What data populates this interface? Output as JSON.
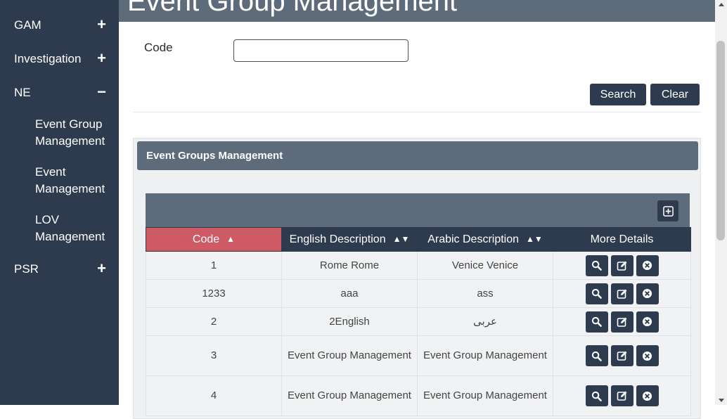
{
  "sidebar": {
    "items": [
      {
        "label": "GAM",
        "toggle": "+"
      },
      {
        "label": "Investigation",
        "toggle": "+"
      },
      {
        "label": "NE",
        "toggle": "−"
      },
      {
        "label": "PSR",
        "toggle": "+"
      }
    ],
    "sub_items": [
      "Event Group Management",
      "Event Management",
      "LOV Management"
    ]
  },
  "page": {
    "title": "Event Group Management"
  },
  "search": {
    "code_label": "Code",
    "code_value": "",
    "search_label": "Search",
    "clear_label": "Clear"
  },
  "panel": {
    "title": "Event Groups Management"
  },
  "table": {
    "columns": [
      "Code",
      "English Description",
      "Arabic Description",
      "More Details"
    ],
    "rows": [
      {
        "code": "1",
        "english": "Rome Rome",
        "arabic": "Venice Venice"
      },
      {
        "code": "1233",
        "english": "aaa",
        "arabic": "ass"
      },
      {
        "code": "2",
        "english": "2English",
        "arabic": "عربى"
      },
      {
        "code": "3",
        "english": "Event Group Management",
        "arabic": "Event Group Management"
      },
      {
        "code": "4",
        "english": "Event Group Management",
        "arabic": "Event Group Management"
      }
    ]
  },
  "colors": {
    "sidebar": "#2e3b4e",
    "header": "#5d6b7a",
    "active_sort": "#cd5a65"
  },
  "icons": {
    "expand": "plus-icon",
    "collapse": "minus-icon",
    "add": "plus-square-icon",
    "view": "search-icon",
    "edit": "edit-icon",
    "delete": "close-circle-icon"
  }
}
